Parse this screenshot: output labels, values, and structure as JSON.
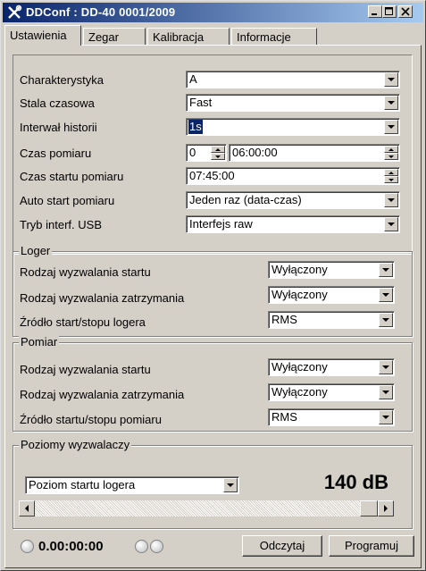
{
  "window": {
    "title": "DDConf : DD-40 0001/2009",
    "controls": [
      "minimize-icon",
      "maximize-icon",
      "close-icon"
    ]
  },
  "tabs": [
    "Ustawienia",
    "Zegar",
    "Kalibracja",
    "Informacje"
  ],
  "active_tab": "Ustawienia",
  "settings": {
    "charakterystyka": {
      "label": "Charakterystyka",
      "value": "A"
    },
    "stala": {
      "label": "Stala czasowa",
      "value": "Fast"
    },
    "interwal": {
      "label": "Interwał historii",
      "value": "1s"
    },
    "czas_pomiaru": {
      "label": "Czas pomiaru",
      "days": "0",
      "time": "06:00:00"
    },
    "czas_startu": {
      "label": "Czas startu pomiaru",
      "value": "07:45:00"
    },
    "auto_start": {
      "label": "Auto start pomiaru",
      "value": "Jeden raz (data-czas)"
    },
    "tryb_usb": {
      "label": "Tryb interf. USB",
      "value": "Interfejs raw"
    }
  },
  "loger": {
    "title": "Loger",
    "rows": [
      {
        "label": "Rodzaj wyzwalania startu",
        "value": "Wyłączony"
      },
      {
        "label": "Rodzaj wyzwalania zatrzymania",
        "value": "Wyłączony"
      },
      {
        "label": "Źródło start/stopu logera",
        "value": "RMS"
      }
    ]
  },
  "pomiar": {
    "title": "Pomiar",
    "rows": [
      {
        "label": "Rodzaj wyzwalania startu",
        "value": "Wyłączony"
      },
      {
        "label": "Rodzaj wyzwalania zatrzymania",
        "value": "Wyłączony"
      },
      {
        "label": "Źródło startu/stopu pomiaru",
        "value": "RMS"
      }
    ]
  },
  "poziomy": {
    "title": "Poziomy wyzwalaczy",
    "select": "Poziom startu logera",
    "level": "140 dB",
    "slider_fraction": 1.0
  },
  "footer": {
    "timer": "0.00:00:00",
    "read_button": "Odczytaj",
    "program_button": "Programuj"
  },
  "colors": {
    "titlebar_start": "#0a246a",
    "titlebar_end": "#a6caf0",
    "selection": "#0a246a",
    "face": "#d4d0c8"
  }
}
